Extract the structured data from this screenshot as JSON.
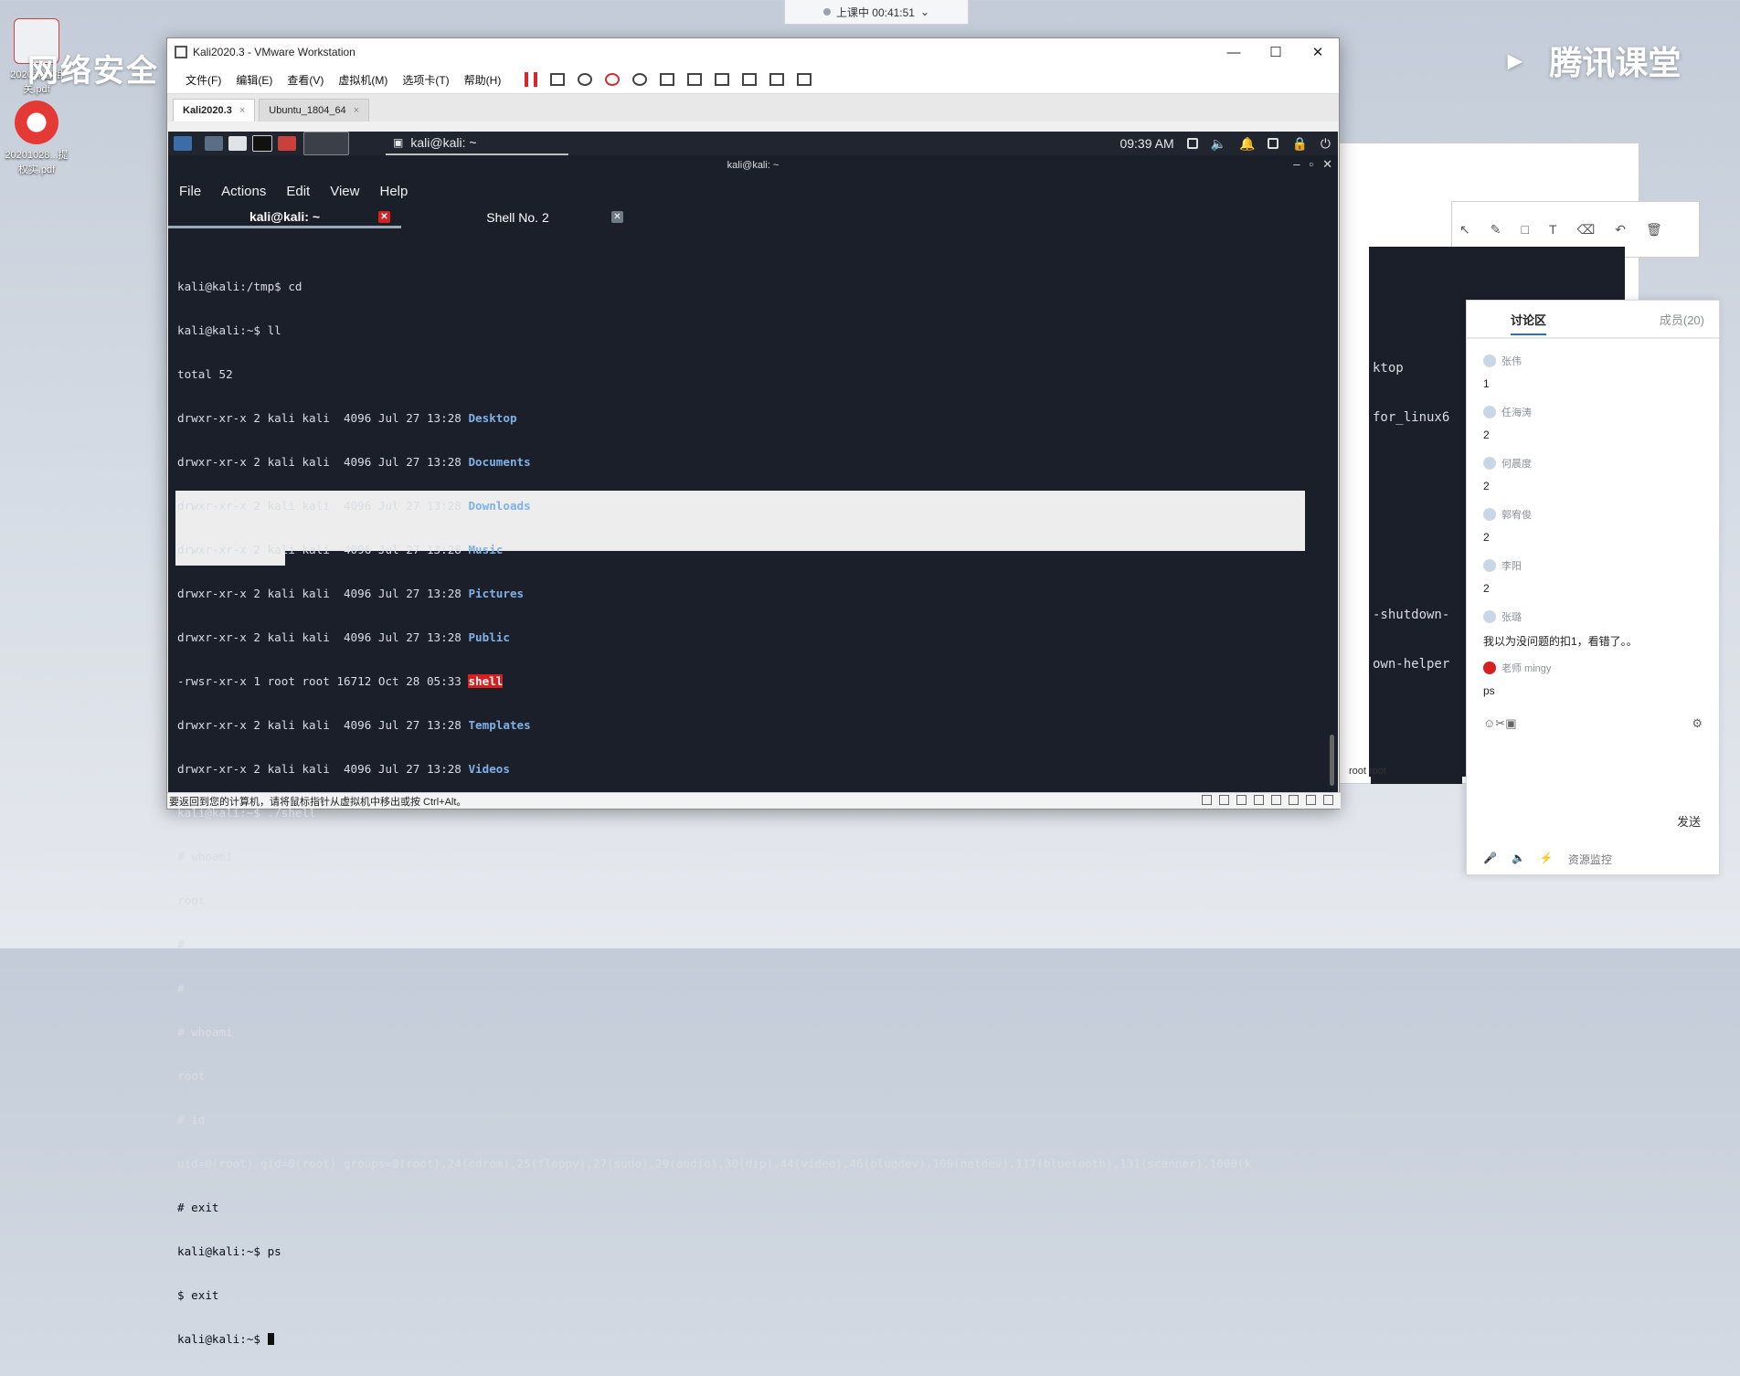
{
  "desktop": {
    "icon1_label": "2020弹窗相关.pdf",
    "icon2_label": "20201028...提权实.pdf",
    "wallpaper_text": "网络安全"
  },
  "live_bar": {
    "status": "上课中 00:41:51"
  },
  "brand": "腾讯课堂",
  "vmware": {
    "title": "Kali2020.3 - VMware Workstation",
    "menu": [
      "文件(F)",
      "编辑(E)",
      "查看(V)",
      "虚拟机(M)",
      "选项卡(T)",
      "帮助(H)"
    ],
    "tabs": [
      "Kali2020.3",
      "Ubuntu_1804_64"
    ],
    "status_text": "要返回到您的计算机，请将鼠标指针从虚拟机中移出或按 Ctrl+Alt。"
  },
  "kali_panel": {
    "task_label": "kali@kali: ~",
    "clock": "09:39 AM"
  },
  "terminal": {
    "window_title": "kali@kali: ~",
    "menu": [
      "File",
      "Actions",
      "Edit",
      "View",
      "Help"
    ],
    "tabs": [
      "kali@kali: ~",
      "Shell No. 2"
    ],
    "lines": [
      "kali@kali:/tmp$ cd",
      "kali@kali:~$ ll",
      "total 52",
      "drwxr-xr-x 2 kali kali  4096 Jul 27 13:28 ",
      "drwxr-xr-x 2 kali kali  4096 Jul 27 13:28 ",
      "drwxr-xr-x 2 kali kali  4096 Jul 27 13:28 ",
      "drwxr-xr-x 2 kali kali  4096 Jul 27 13:28 ",
      "drwxr-xr-x 2 kali kali  4096 Jul 27 13:28 ",
      "drwxr-xr-x 2 kali kali  4096 Jul 27 13:28 ",
      "-rwsr-xr-x 1 root root 16712 Oct 28 05:33 ",
      "drwxr-xr-x 2 kali kali  4096 Jul 27 13:28 ",
      "drwxr-xr-x 2 kali kali  4096 Jul 27 13:28 ",
      "kali@kali:~$ ./shell",
      "# whoami",
      "root",
      "#",
      "#",
      "# whoami",
      "root",
      "# id",
      "uid=0(root) gid=0(root) groups=0(root),24(cdrom),25(floppy),27(sudo),29(audio),30(dip),44(video),46(plugdev),109(netdev),117(bluetooth),131(scanner),1000(k",
      "# exit",
      "kali@kali:~$ ps",
      "$ exit",
      "kali@kali:~$ "
    ],
    "dirs": [
      "Desktop",
      "Documents",
      "Downloads",
      "Music",
      "Pictures",
      "Public",
      "shell",
      "Templates",
      "Videos"
    ]
  },
  "background_terminal": {
    "lines": [
      "ktop",
      "for_linux6",
      "",
      "",
      "",
      "",
      "",
      "",
      "-shutdown-",
      "own-helper"
    ],
    "footer": "root root"
  },
  "discussion": {
    "title": "讨论区",
    "members": "成员(20)",
    "messages": [
      {
        "user": "张伟",
        "text": "1"
      },
      {
        "user": "任海涛",
        "text": "2"
      },
      {
        "user": "何晨度",
        "text": "2"
      },
      {
        "user": "郭宥俊",
        "text": "2"
      },
      {
        "user": "李阳",
        "text": "2"
      },
      {
        "user": "张璐",
        "text": "我以为没问题的扣1，看错了。。"
      },
      {
        "user": "老师 mingy",
        "text": "ps"
      }
    ],
    "send_label": "发送",
    "footer_label": "资源监控"
  }
}
